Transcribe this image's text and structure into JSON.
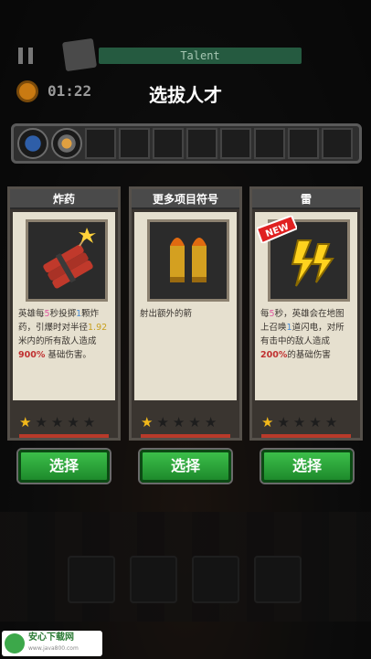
{
  "hud": {
    "talent_label": "Talent",
    "timer": "01:22"
  },
  "title": "选拔人才",
  "skill_slots": {
    "filled": [
      "shockwave-icon",
      "gear-blade-icon"
    ],
    "empty_count": 8
  },
  "cards": [
    {
      "title": "炸药",
      "icon": "dynamite-icon",
      "desc_parts": [
        "英雄每",
        "5",
        "秒投掷",
        "1",
        "颗炸药，引爆时对半径",
        "1.92",
        "米内的所有敌人造成",
        "900%",
        "基础伤害。"
      ],
      "stars": 1,
      "button": "选择"
    },
    {
      "title": "更多项目符号",
      "icon": "bullets-icon",
      "desc": "射出额外的箭",
      "stars": 1,
      "button": "选择"
    },
    {
      "title": "雷",
      "icon": "lightning-icon",
      "badge": "NEW",
      "desc_parts": [
        "每",
        "5",
        "秒，英雄会在地图上召唤",
        "1",
        "道闪电，对所有击中的敌人造成",
        "200%",
        "的基础伤害"
      ],
      "stars": 1,
      "button": "选择"
    }
  ],
  "watermark": {
    "name": "安心下载网",
    "url": "www.java800.com"
  },
  "colors": {
    "button_green": "#2ea43c",
    "star_gold": "#f2b81a",
    "highlight_pink": "#e05aa0",
    "highlight_blue": "#4a8ad0",
    "highlight_yellow": "#c8a020",
    "highlight_red": "#c03030"
  }
}
